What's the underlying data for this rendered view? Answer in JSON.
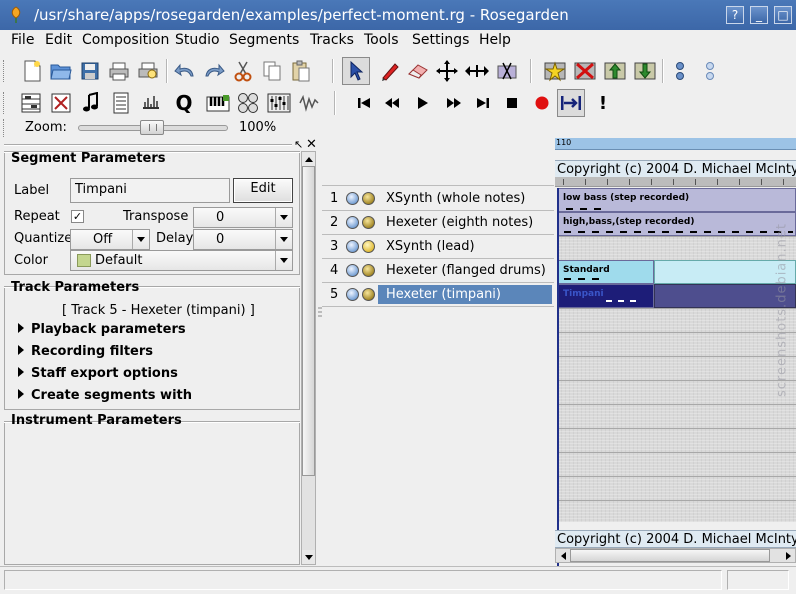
{
  "window": {
    "title": "/usr/share/apps/rosegarden/examples/perfect-moment.rg - Rosegarden",
    "buttons": [
      "help-button",
      "minimize-button",
      "maximize-button",
      "close-button"
    ]
  },
  "menubar": {
    "items": [
      "File",
      "Edit",
      "Composition",
      "Studio",
      "Segments",
      "Tracks",
      "Tools",
      "Settings",
      "Help"
    ]
  },
  "toolbar1": {
    "icons": [
      "new-file-icon",
      "open-file-icon",
      "save-file-icon",
      "print-icon",
      "print-preview-icon",
      "undo-icon",
      "redo-icon",
      "cut-icon",
      "copy-icon",
      "paste-icon",
      "select-tool-icon",
      "draw-tool-icon",
      "erase-tool-icon",
      "move-tool-icon",
      "resize-tool-icon",
      "split-tool-icon",
      "add-tracks-icon",
      "delete-track-icon",
      "move-track-up-icon",
      "move-track-down-icon",
      "mute-all-icon",
      "unmute-all-icon"
    ]
  },
  "toolbar2": {
    "icons": [
      "matrix-editor-icon",
      "percussion-editor-icon",
      "notation-editor-icon",
      "event-list-icon",
      "audio-mixer-icon",
      "quantize-icon",
      "midi-keyboard-icon",
      "device-manager-icon",
      "midi-mixer-icon",
      "audio-device-icon",
      "rewind-to-beginning-icon",
      "rewind-icon",
      "play-icon",
      "fast-forward-icon",
      "fast-forward-to-end-icon",
      "stop-icon",
      "record-icon",
      "loop-icon",
      "panic-icon"
    ]
  },
  "zoom": {
    "label": "Zoom:",
    "value": "100%",
    "level_percent": 100
  },
  "segment_params": {
    "title": "Segment Parameters",
    "label_label": "Label",
    "label_value": "Timpani",
    "edit_button": "Edit",
    "repeat_label": "Repeat",
    "repeat_checked": "✓",
    "transpose_label": "Transpose",
    "transpose_value": "0",
    "quantize_label": "Quantize",
    "quantize_value": "Off",
    "delay_label": "Delay",
    "delay_value": "0",
    "color_label": "Color",
    "color_value": "Default",
    "color_swatch": "#c4d68f"
  },
  "track_params": {
    "title": "Track Parameters",
    "track_name": "[ Track 5 - Hexeter (timpani) ]",
    "sections": [
      "Playback parameters",
      "Recording filters",
      "Staff export options",
      "Create segments with"
    ]
  },
  "instrument_params": {
    "title": "Instrument Parameters"
  },
  "tracks": [
    {
      "num": "1",
      "name": "XSynth (whole notes)",
      "selected": false
    },
    {
      "num": "2",
      "name": "Hexeter (eighth notes)",
      "selected": false
    },
    {
      "num": "3",
      "name": "XSynth (lead)",
      "selected": false
    },
    {
      "num": "4",
      "name": "Hexeter (flanged drums)",
      "selected": false
    },
    {
      "num": "5",
      "name": "Hexeter (timpani)",
      "selected": true
    }
  ],
  "canvas": {
    "ruler_label": "110",
    "copyright_text": "Copyright (c) 2004 D. Michael McIntyre",
    "segments": [
      {
        "name": "low bass (step recorded)",
        "color": "#b9b9d9"
      },
      {
        "name": "high,bass,(step recorded)",
        "color": "#b9b9d9"
      },
      {
        "name": "Standard",
        "color": "#9fdbec"
      },
      {
        "name": "Timpani",
        "color": "#1d1d78"
      }
    ]
  },
  "watermark": {
    "text": "screenshots.debian.net"
  },
  "colors": {
    "title_bar": "#3c67a8",
    "selection": "#5b86ba",
    "playhead": "#20308a",
    "record_red": "#e01010"
  }
}
